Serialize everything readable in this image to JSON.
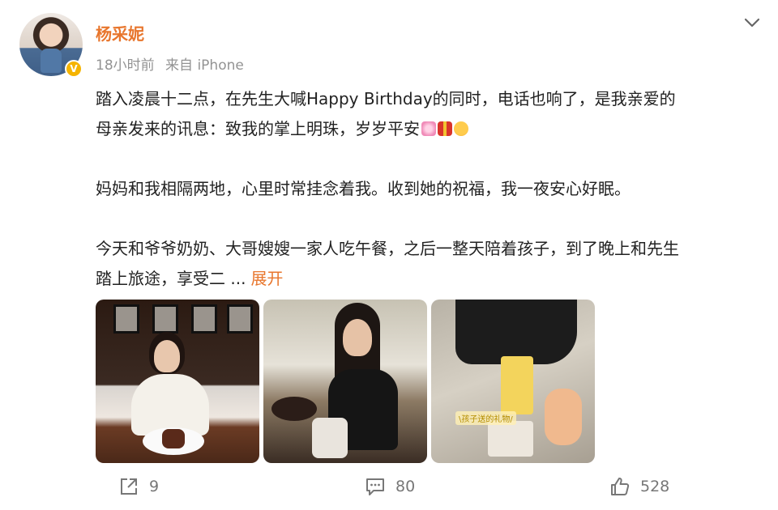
{
  "post": {
    "username": "杨采妮",
    "verified_icon": "verified-badge-icon",
    "time": "18小时前",
    "source": "来自 iPhone",
    "menu_icon": "chevron-down-icon",
    "paragraphs": [
      "踏入凌晨十二点，在先生大喊Happy Birthday的同时，电话也响了，是我亲爱的",
      "母亲发来的讯息：致我的掌上明珠，岁岁平安",
      "妈妈和我相隔两地，心里时常挂念着我。收到她的祝福，我一夜安心好眠。",
      "今天和爷爷奶奶、大哥嫂嫂一家人吃午餐，之后一整天陪着孩子，到了晚上和先生",
      "踏上旅途，享受二  ..."
    ],
    "expand_label": "展开",
    "photo_sticker": "\\孩子送的礼物/",
    "colors": {
      "accent": "#e8762d",
      "meta": "#939393"
    }
  },
  "actions": {
    "repost_count": "9",
    "comment_count": "80",
    "like_count": "528"
  }
}
